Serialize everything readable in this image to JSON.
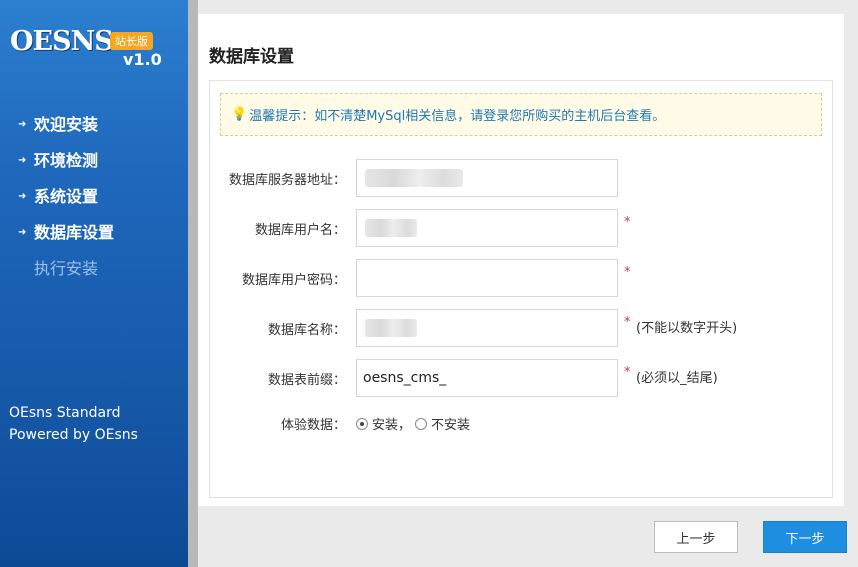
{
  "brand": {
    "logo_text": "OESNS",
    "badge": "站长版",
    "version": "v1.0"
  },
  "nav": {
    "items": [
      {
        "label": "欢迎安装",
        "state": "done"
      },
      {
        "label": "环境检测",
        "state": "done"
      },
      {
        "label": "系统设置",
        "state": "done"
      },
      {
        "label": "数据库设置",
        "state": "active"
      },
      {
        "label": "执行安装",
        "state": "disabled"
      }
    ]
  },
  "footer": {
    "line1": "OEsns Standard",
    "line2": "Powered by OEsns"
  },
  "page": {
    "title": "数据库设置"
  },
  "tip": {
    "text": "温馨提示：如不清楚MySql相关信息，请登录您所购买的主机后台查看。"
  },
  "form": {
    "db_host": {
      "label": "数据库服务器地址：",
      "value": ""
    },
    "db_user": {
      "label": "数据库用户名：",
      "value": "",
      "required": "*"
    },
    "db_pass": {
      "label": "数据库用户密码：",
      "value": "",
      "required": "*"
    },
    "db_name": {
      "label": "数据库名称：",
      "value": "",
      "required": "*",
      "hint": "(不能以数字开头)"
    },
    "db_prefix": {
      "label": "数据表前缀：",
      "value": "oesns_cms_",
      "required": "*",
      "hint": "(必须以_结尾)"
    },
    "demo_data": {
      "label": "体验数据：",
      "options": [
        "安装，",
        "不安装"
      ],
      "selected": 0
    }
  },
  "buttons": {
    "prev": "上一步",
    "next": "下一步"
  },
  "colors": {
    "sidebar": "#1f68bc",
    "accent": "#1e8fe0",
    "tip_text": "#1d7ab7",
    "required": "#d33333"
  }
}
